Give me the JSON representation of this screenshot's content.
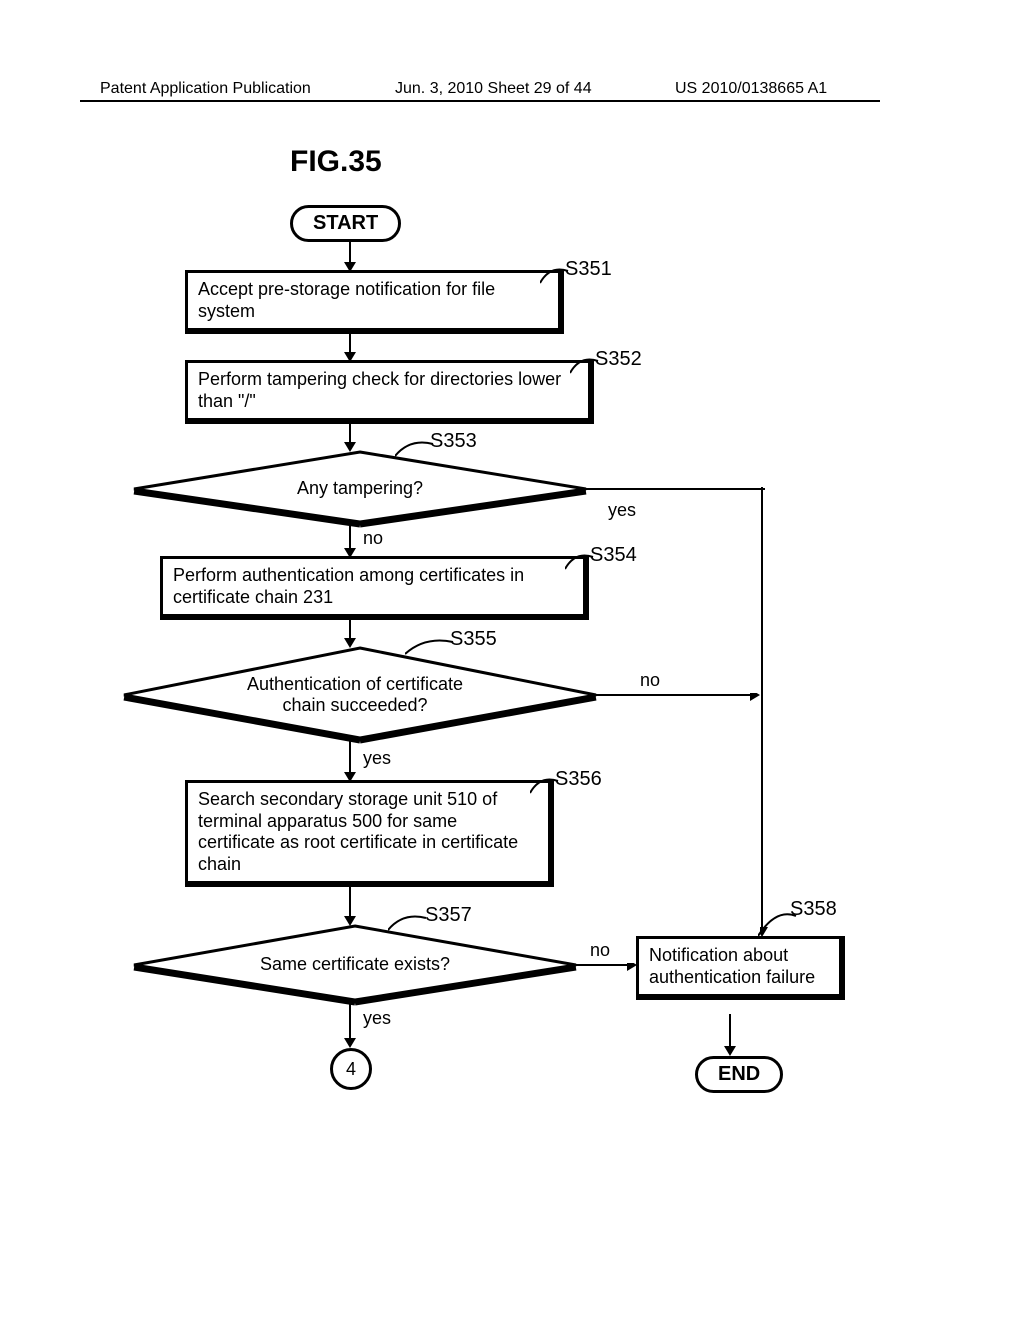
{
  "header": {
    "left": "Patent Application Publication",
    "center": "Jun. 3, 2010  Sheet 29 of 44",
    "right": "US 2010/0138665 A1"
  },
  "figure_title": "FIG.35",
  "nodes": {
    "start": "START",
    "s351": {
      "label": "S351",
      "text": "Accept pre-storage notification for file system"
    },
    "s352": {
      "label": "S352",
      "text": "Perform tampering check for directories lower than \"/\""
    },
    "s353": {
      "label": "S353",
      "text": "Any tampering?"
    },
    "s354": {
      "label": "S354",
      "text": "Perform authentication among certificates in certificate chain 231"
    },
    "s355": {
      "label": "S355",
      "text": "Authentication of certificate chain succeeded?"
    },
    "s356": {
      "label": "S356",
      "text": "Search secondary storage unit 510 of terminal apparatus 500 for same certificate as root certificate in certificate chain"
    },
    "s357": {
      "label": "S357",
      "text": "Same certificate exists?"
    },
    "s358": {
      "label": "S358",
      "text": "Notification about authentication failure"
    },
    "end": "END",
    "connector": "4"
  },
  "edges": {
    "yes": "yes",
    "no": "no"
  }
}
